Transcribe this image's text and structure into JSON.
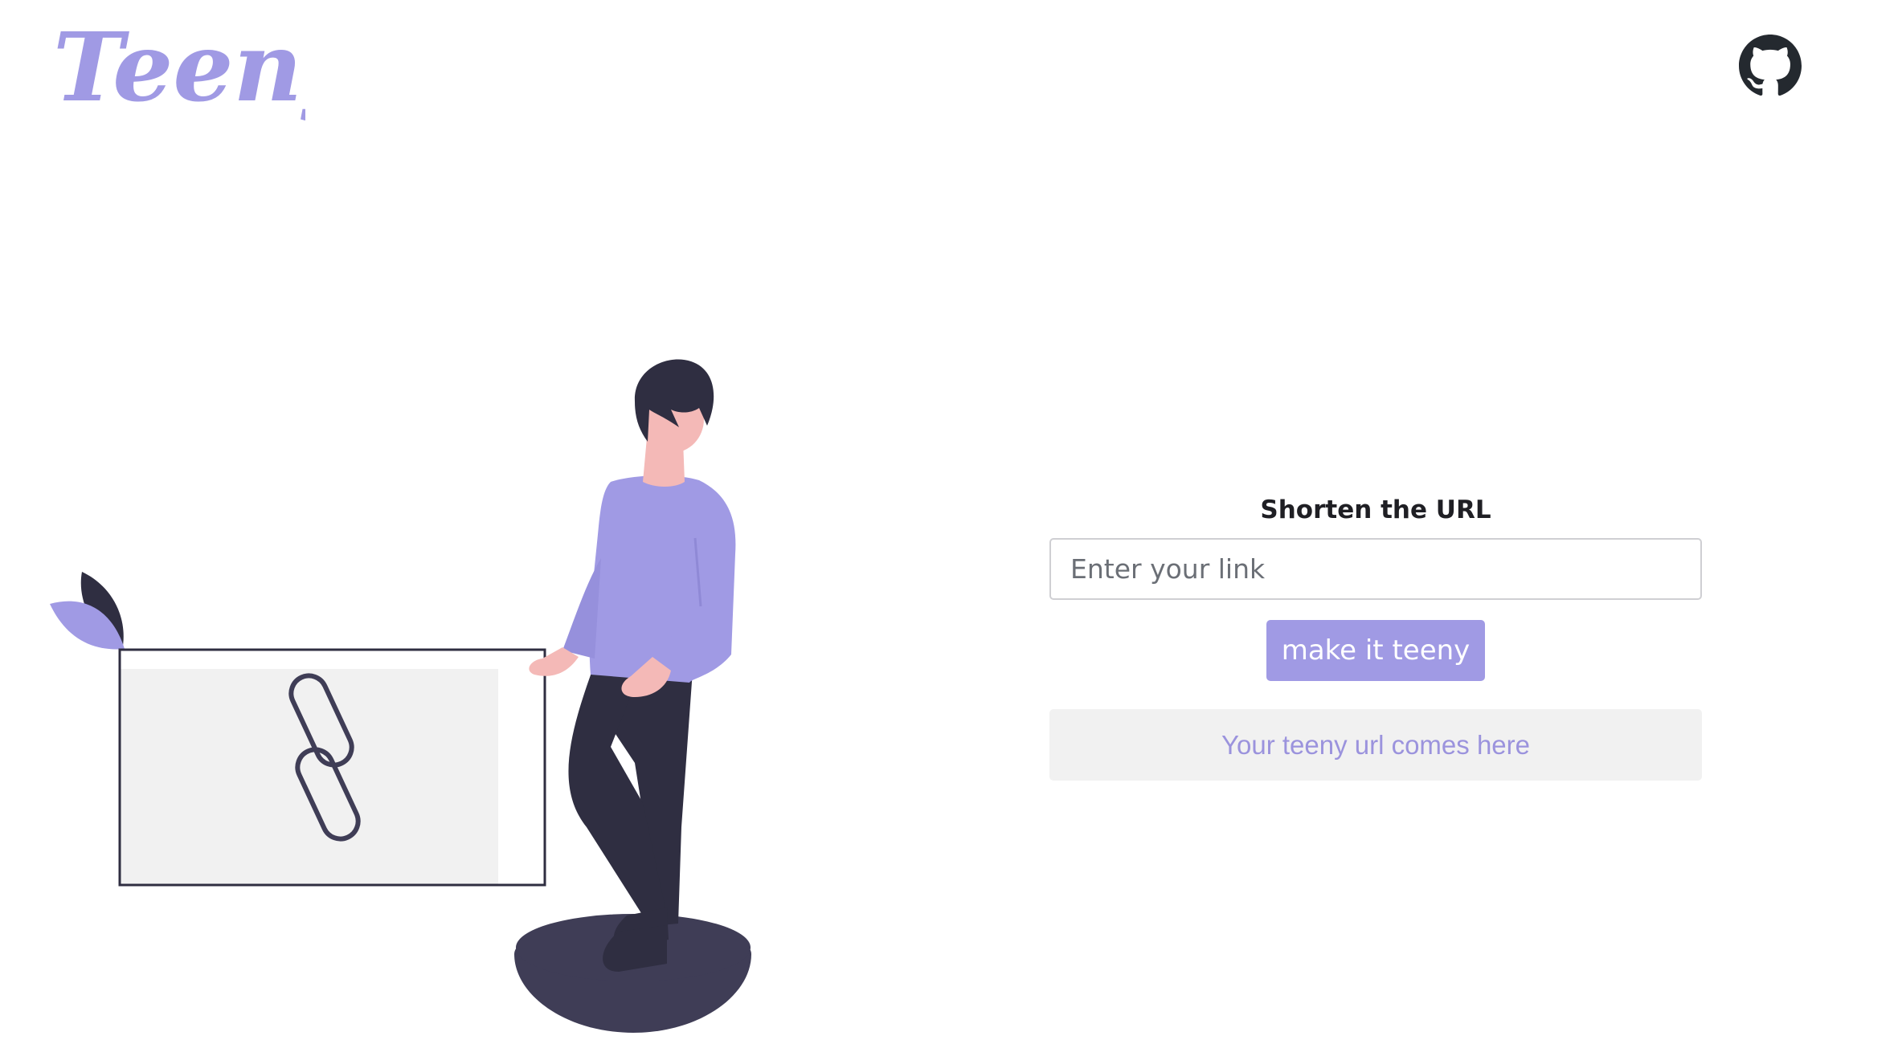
{
  "brand": {
    "logo_text": "Teeny",
    "accent_color": "#a09ae4",
    "dark_color": "#2f2e41"
  },
  "header": {
    "github_icon": "github-icon"
  },
  "shortener": {
    "title": "Shorten the URL",
    "input_placeholder": "Enter your link",
    "input_value": "",
    "button_label": "make it teeny",
    "result_placeholder": "Your teeny url comes here"
  },
  "illustration": {
    "icon": "link-chain-icon"
  }
}
